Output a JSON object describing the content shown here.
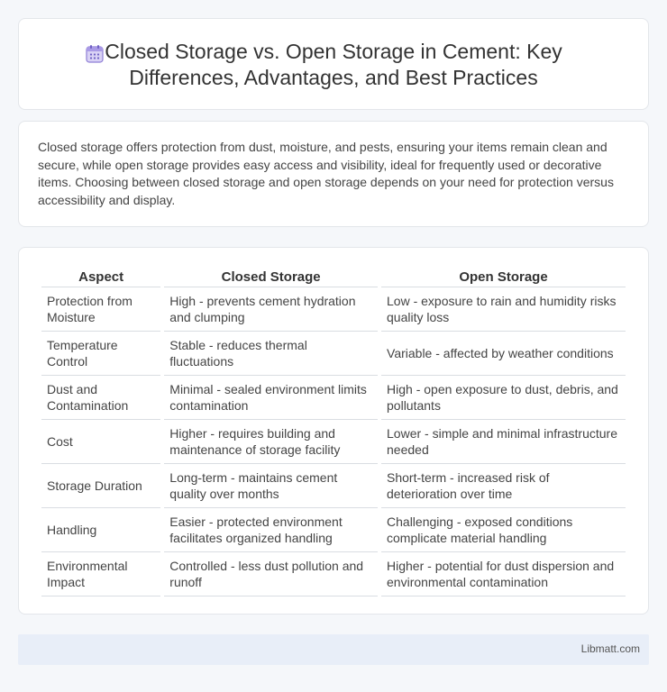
{
  "header": {
    "title": "Closed Storage vs. Open Storage in Cement: Key Differences, Advantages, and Best Practices",
    "icon": "calendar-grid-icon"
  },
  "intro": {
    "text": "Closed storage offers protection from dust, moisture, and pests, ensuring your items remain clean and secure, while open storage provides easy access and visibility, ideal for frequently used or decorative items. Choosing between closed storage and open storage depends on your need for protection versus accessibility and display."
  },
  "table": {
    "headers": [
      "Aspect",
      "Closed Storage",
      "Open Storage"
    ],
    "rows": [
      [
        "Protection from Moisture",
        "High - prevents cement hydration and clumping",
        "Low - exposure to rain and humidity risks quality loss"
      ],
      [
        "Temperature Control",
        "Stable - reduces thermal fluctuations",
        "Variable - affected by weather conditions"
      ],
      [
        "Dust and Contamination",
        "Minimal - sealed environment limits contamination",
        "High - open exposure to dust, debris, and pollutants"
      ],
      [
        "Cost",
        "Higher - requires building and maintenance of storage facility",
        "Lower - simple and minimal infrastructure needed"
      ],
      [
        "Storage Duration",
        "Long-term - maintains cement quality over months",
        "Short-term - increased risk of deterioration over time"
      ],
      [
        "Handling",
        "Easier - protected environment facilitates organized handling",
        "Challenging - exposed conditions complicate material handling"
      ],
      [
        "Environmental Impact",
        "Controlled - less dust pollution and runoff",
        "Higher - potential for dust dispersion and environmental contamination"
      ]
    ]
  },
  "footer": {
    "site": "Libmatt.com"
  }
}
